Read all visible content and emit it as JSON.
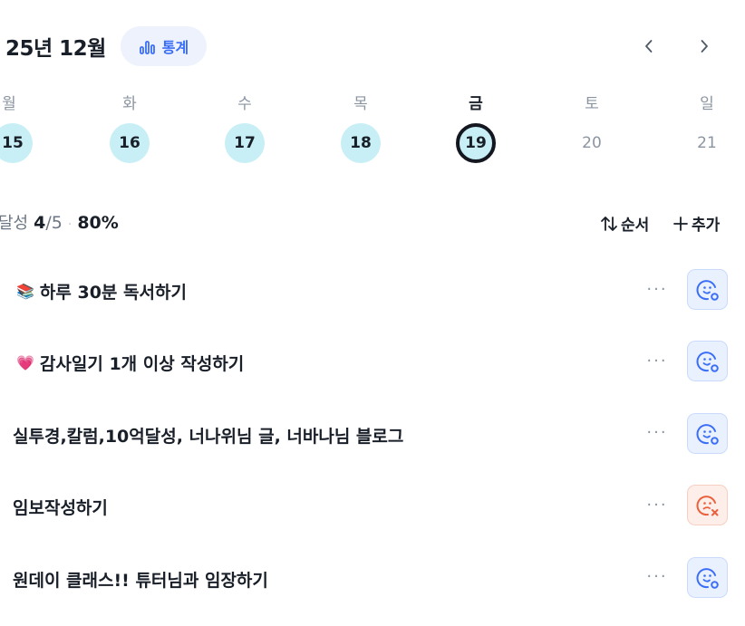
{
  "header": {
    "month_title": "25년 12월",
    "stats_label": "통계",
    "stats_icon": "bar-chart-icon",
    "prev_icon": "chevron-left-icon",
    "next_icon": "chevron-right-icon"
  },
  "week": {
    "days": [
      {
        "dow": "월",
        "date": "15",
        "state": "done"
      },
      {
        "dow": "화",
        "date": "16",
        "state": "done"
      },
      {
        "dow": "수",
        "date": "17",
        "state": "done"
      },
      {
        "dow": "목",
        "date": "18",
        "state": "done"
      },
      {
        "dow": "금",
        "date": "19",
        "state": "today"
      },
      {
        "dow": "토",
        "date": "20",
        "state": "plain"
      },
      {
        "dow": "일",
        "date": "21",
        "state": "plain"
      }
    ]
  },
  "progress": {
    "label": "달성",
    "done": "4",
    "total": "/5",
    "separator": "·",
    "percent": "80%"
  },
  "toolbar": {
    "sort_label": "순서",
    "add_label": "추가"
  },
  "tasks": [
    {
      "emoji": "📚",
      "title": "하루 30분 독서하기",
      "status": "ok"
    },
    {
      "emoji": "💗",
      "title": "감사일기 1개 이상 작성하기",
      "status": "ok"
    },
    {
      "emoji": "",
      "title": "실투경,칼럼,10억달성, 너나위님 글, 너바나님 블로그",
      "status": "ok"
    },
    {
      "emoji": "",
      "title": "임보작성하기",
      "status": "fail"
    },
    {
      "emoji": "",
      "title": "원데이 클래스!! 튜터님과 임장하기",
      "status": "ok"
    }
  ],
  "more_label": "···",
  "colors": {
    "accent": "#3b6ef6",
    "done_circle": "#c7eff5",
    "ok_face": "#3b6ef6",
    "fail_face": "#e8603c"
  }
}
